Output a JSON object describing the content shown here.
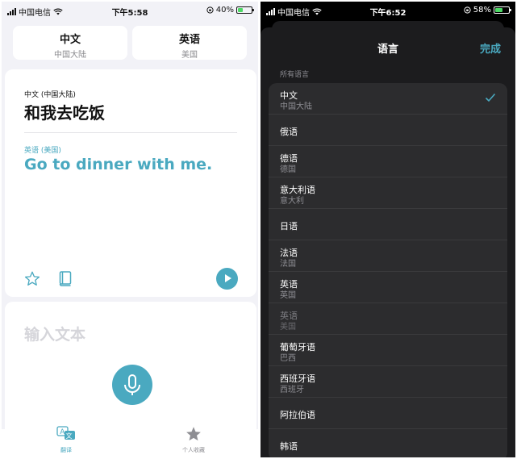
{
  "left": {
    "status": {
      "carrier": "中国电信",
      "time": "下午5:58",
      "battery": "40%",
      "battery_level": 0.4
    },
    "language_buttons": [
      {
        "name": "中文",
        "region": "中国大陆"
      },
      {
        "name": "英语",
        "region": "美国"
      }
    ],
    "card": {
      "source_lang": "中文 (中国大陆)",
      "source_text": "和我去吃饭",
      "target_lang": "英语 (美国)",
      "target_text": "Go to dinner with me."
    },
    "input_placeholder": "输入文本",
    "tabs": [
      {
        "label": "翻译",
        "icon": "translate-icon",
        "active": true
      },
      {
        "label": "个人收藏",
        "icon": "star-icon",
        "active": false
      }
    ]
  },
  "right": {
    "status": {
      "carrier": "中国电信",
      "time": "下午6:52",
      "battery": "58%",
      "battery_level": 0.58
    },
    "sheet": {
      "title": "语言",
      "done": "完成",
      "section": "所有语言"
    },
    "languages": [
      {
        "name": "中文",
        "region": "中国大陆",
        "selected": true,
        "dim": false
      },
      {
        "name": "俄语",
        "region": "",
        "selected": false,
        "dim": false
      },
      {
        "name": "德语",
        "region": "德国",
        "selected": false,
        "dim": false
      },
      {
        "name": "意大利语",
        "region": "意大利",
        "selected": false,
        "dim": false
      },
      {
        "name": "日语",
        "region": "",
        "selected": false,
        "dim": false
      },
      {
        "name": "法语",
        "region": "法国",
        "selected": false,
        "dim": false
      },
      {
        "name": "英语",
        "region": "英国",
        "selected": false,
        "dim": false
      },
      {
        "name": "英语",
        "region": "美国",
        "selected": false,
        "dim": true
      },
      {
        "name": "葡萄牙语",
        "region": "巴西",
        "selected": false,
        "dim": false
      },
      {
        "name": "西班牙语",
        "region": "西班牙",
        "selected": false,
        "dim": false
      },
      {
        "name": "阿拉伯语",
        "region": "",
        "selected": false,
        "dim": false
      },
      {
        "name": "韩语",
        "region": "",
        "selected": false,
        "dim": false
      }
    ]
  },
  "colors": {
    "accent": "#4aa9c0",
    "battery_green": "#4cd964"
  }
}
